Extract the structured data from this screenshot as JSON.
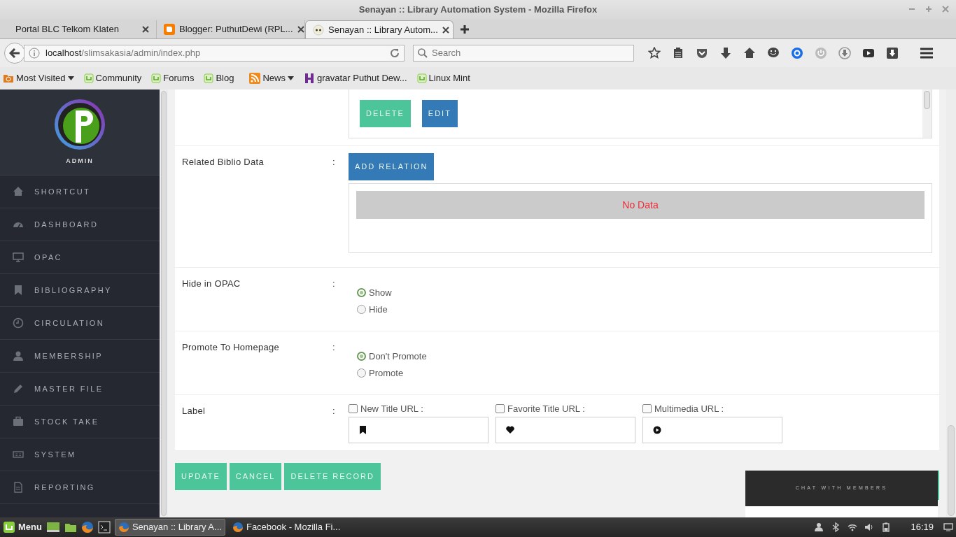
{
  "window": {
    "title": "Senayan :: Library Automation System - Mozilla Firefox"
  },
  "tabs": [
    {
      "label": "Portal BLC Telkom Klaten",
      "selected": false
    },
    {
      "label": "Blogger: PuthutDewi (RPL...",
      "selected": false
    },
    {
      "label": "Senayan :: Library Autom...",
      "selected": true
    }
  ],
  "address": {
    "host": "localhost",
    "path": "/slimsakasia/admin/index.php"
  },
  "search": {
    "placeholder": "Search"
  },
  "bookmarks": [
    {
      "label": "Most Visited",
      "dropdown": true
    },
    {
      "label": "Community",
      "dropdown": false
    },
    {
      "label": "Forums",
      "dropdown": false
    },
    {
      "label": "Blog",
      "dropdown": false
    },
    {
      "label": "News",
      "dropdown": true
    },
    {
      "label": "gravatar Puthut Dew...",
      "dropdown": false
    },
    {
      "label": "Linux Mint",
      "dropdown": false
    }
  ],
  "sidebar": {
    "user": "ADMIN",
    "items": [
      {
        "label": "SHORTCUT"
      },
      {
        "label": "DASHBOARD"
      },
      {
        "label": "OPAC"
      },
      {
        "label": "BIBLIOGRAPHY"
      },
      {
        "label": "CIRCULATION"
      },
      {
        "label": "MEMBERSHIP"
      },
      {
        "label": "MASTER FILE"
      },
      {
        "label": "STOCK TAKE"
      },
      {
        "label": "SYSTEM"
      },
      {
        "label": "REPORTING"
      }
    ]
  },
  "form": {
    "rows": [
      {
        "kind": "attachments",
        "buttons": [
          {
            "label": "DELETE",
            "color": "#4dc59b"
          },
          {
            "label": "EDIT",
            "color": "#337ab7"
          }
        ]
      },
      {
        "kind": "relation",
        "label": "Related Biblio Data",
        "colon": ":",
        "button": "ADD RELATION",
        "empty_text": "No Data"
      },
      {
        "kind": "radio",
        "label": "Hide in OPAC",
        "colon": ":",
        "options": [
          {
            "label": "Show",
            "selected": true
          },
          {
            "label": "Hide",
            "selected": false
          }
        ]
      },
      {
        "kind": "radio",
        "label": "Promote To Homepage",
        "colon": ":",
        "options": [
          {
            "label": "Don't Promote",
            "selected": true
          },
          {
            "label": "Promote",
            "selected": false
          }
        ]
      },
      {
        "kind": "labels",
        "label": "Label",
        "colon": ":",
        "items": [
          {
            "label": "New Title URL :",
            "checked": false
          },
          {
            "label": "Favorite Title URL :",
            "checked": false
          },
          {
            "label": "Multimedia URL :",
            "checked": false
          }
        ]
      }
    ],
    "actions": [
      "UPDATE",
      "CANCEL",
      "DELETE RECORD"
    ]
  },
  "chat": {
    "title": "CHAT WITH MEMBERS"
  },
  "taskbar": {
    "menu": "Menu",
    "windows": [
      {
        "label": "Senayan :: Library A...",
        "selected": true
      },
      {
        "label": "Facebook - Mozilla Fi...",
        "selected": false
      }
    ],
    "clock": "16:19"
  }
}
